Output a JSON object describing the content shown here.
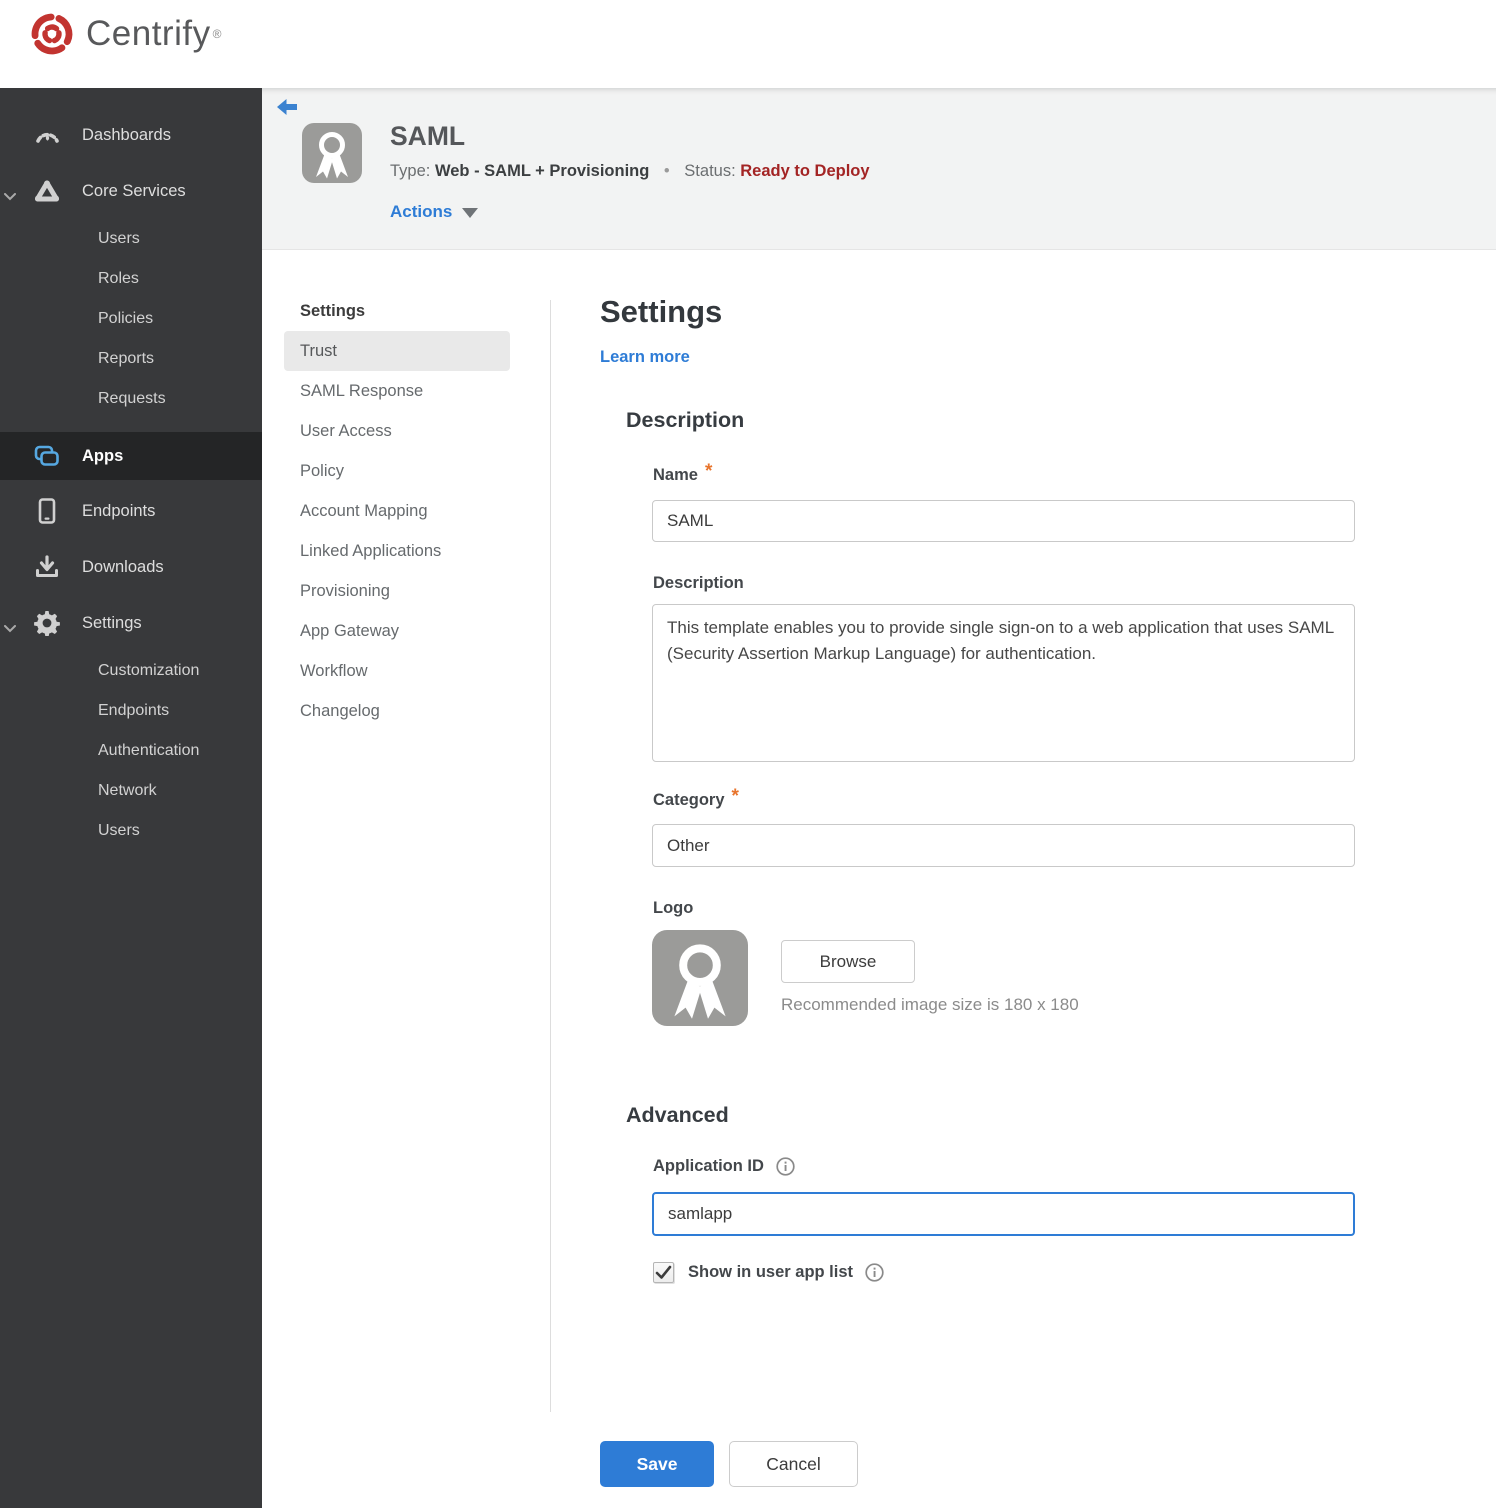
{
  "brand": {
    "name": "Centrify",
    "trademark": "®"
  },
  "sidebar": {
    "items": [
      {
        "label": "Dashboards"
      },
      {
        "label": "Core Services"
      },
      {
        "label": "Users"
      },
      {
        "label": "Roles"
      },
      {
        "label": "Policies"
      },
      {
        "label": "Reports"
      },
      {
        "label": "Requests"
      },
      {
        "label": "Apps"
      },
      {
        "label": "Endpoints"
      },
      {
        "label": "Downloads"
      },
      {
        "label": "Settings"
      },
      {
        "label": "Customization"
      },
      {
        "label": "Endpoints"
      },
      {
        "label": "Authentication"
      },
      {
        "label": "Network"
      },
      {
        "label": "Users"
      }
    ]
  },
  "header": {
    "title": "SAML",
    "type_label": "Type:",
    "type_value": "Web - SAML + Provisioning",
    "separator": "•",
    "status_label": "Status:",
    "status_value": "Ready to Deploy",
    "actions_label": "Actions"
  },
  "subnav": {
    "title": "Settings",
    "items": [
      {
        "label": "Trust",
        "selected": true
      },
      {
        "label": "SAML Response"
      },
      {
        "label": "User Access"
      },
      {
        "label": "Policy"
      },
      {
        "label": "Account Mapping"
      },
      {
        "label": "Linked Applications"
      },
      {
        "label": "Provisioning"
      },
      {
        "label": "App Gateway"
      },
      {
        "label": "Workflow"
      },
      {
        "label": "Changelog"
      }
    ]
  },
  "main": {
    "title": "Settings",
    "learn_more": "Learn more",
    "required_mark": "*",
    "description": {
      "heading": "Description",
      "name_label": "Name",
      "name_value": "SAML",
      "description_label": "Description",
      "description_value": "This template enables you to provide single sign-on to a web application that uses SAML (Security Assertion Markup Language) for authentication.",
      "category_label": "Category",
      "category_value": "Other",
      "logo_label": "Logo",
      "browse_label": "Browse",
      "logo_hint": "Recommended image size is 180 x 180"
    },
    "advanced": {
      "heading": "Advanced",
      "app_id_label": "Application ID",
      "app_id_value": "samlapp",
      "show_in_list_label": "Show in user app list",
      "show_in_list_checked": "checked"
    }
  },
  "footer": {
    "save_label": "Save",
    "cancel_label": "Cancel"
  },
  "colors": {
    "accent_blue": "#2e7cd6",
    "status_red": "#a32424",
    "required_orange": "#e8742c",
    "apps_icon_blue": "#56a8e1",
    "sidebar_bg": "#38393b",
    "sidebar_active_bg": "#242526",
    "header_bg": "#f2f3f3",
    "brand_red": "#c23430"
  }
}
